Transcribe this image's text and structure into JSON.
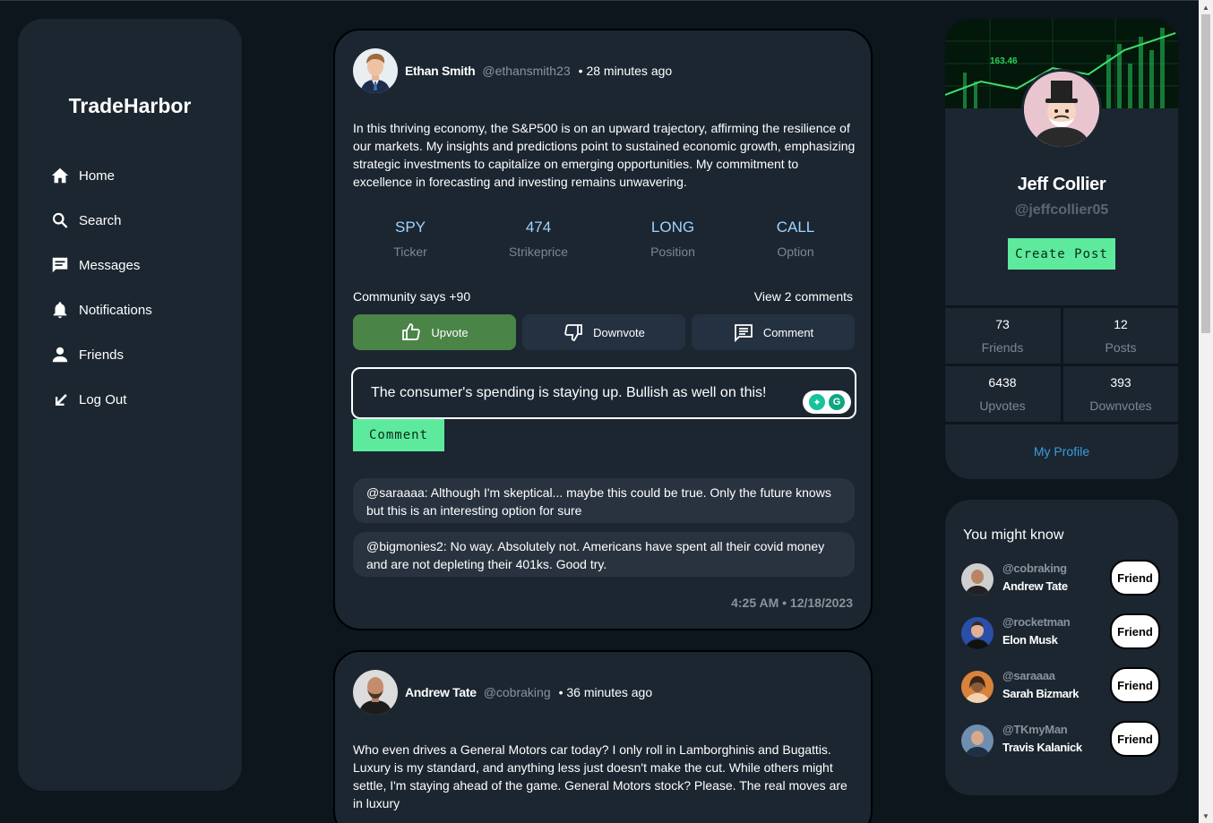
{
  "app": {
    "brand": "TradeHarbor"
  },
  "nav": [
    {
      "label": "Home",
      "icon": "home-icon"
    },
    {
      "label": "Search",
      "icon": "search-icon"
    },
    {
      "label": "Messages",
      "icon": "message-icon"
    },
    {
      "label": "Notifications",
      "icon": "bell-icon"
    },
    {
      "label": "Friends",
      "icon": "person-icon"
    },
    {
      "label": "Log Out",
      "icon": "logout-arrow-icon"
    }
  ],
  "posts": [
    {
      "author": "Ethan Smith",
      "handle": "@ethansmith23",
      "time": "• 28 minutes ago",
      "body": "In this thriving economy, the S&P500 is on an upward trajectory, affirming the resilience of our markets. My insights and predictions point to sustained economic growth, emphasizing strategic investments to capitalize on emerging opportunities. My commitment to excellence in forecasting and investing remains unwavering.",
      "stats": [
        {
          "value": "SPY",
          "label": "Ticker"
        },
        {
          "value": "474",
          "label": "Strikeprice"
        },
        {
          "value": "LONG",
          "label": "Position"
        },
        {
          "value": "CALL",
          "label": "Option"
        }
      ],
      "community": "Community says +90",
      "view_comments": "View 2 comments",
      "actions": {
        "upvote": "Upvote",
        "downvote": "Downvote",
        "comment": "Comment"
      },
      "comment_input_value": "The consumer's spending is staying up. Bullish as well on this!",
      "comment_submit": "Comment",
      "comments": [
        "@saraaaa: Although I'm skeptical... maybe this could be true. Only the future knows but this is an interesting option for sure",
        "@bigmonies2: No way. Absolutely not. Americans have spent all their covid money and are not depleting their 401ks. Good try."
      ],
      "stamp": "4:25 AM • 12/18/2023"
    },
    {
      "author": "Andrew Tate",
      "handle": "@cobraking",
      "time": "• 36 minutes ago",
      "body": "Who even drives a General Motors car today? I only roll in Lamborghinis and Bugattis. Luxury is my standard, and anything less just doesn't make the cut. While others might settle, I'm staying ahead of the game. General Motors stock? Please. The real moves are in luxury"
    }
  ],
  "profile": {
    "name": "Jeff Collier",
    "handle": "@jeffcollier05",
    "create_post": "Create Post",
    "cover_ticker": "163.46",
    "stats": [
      {
        "value": "73",
        "label": "Friends"
      },
      {
        "value": "12",
        "label": "Posts"
      },
      {
        "value": "6438",
        "label": "Upvotes"
      },
      {
        "value": "393",
        "label": "Downvotes"
      }
    ],
    "my_profile": "My Profile"
  },
  "suggestions": {
    "title": "You might know",
    "button": "Friend",
    "people": [
      {
        "handle": "@cobraking",
        "name": "Andrew Tate"
      },
      {
        "handle": "@rocketman",
        "name": "Elon Musk"
      },
      {
        "handle": "@saraaaa",
        "name": "Sarah Bizmark"
      },
      {
        "handle": "@TKmyMan",
        "name": "Travis Kalanick"
      }
    ]
  },
  "colors": {
    "background": "#0d151d",
    "card": "#1b2631",
    "accent_green": "#5dea9d",
    "upvote_green": "#4a8447",
    "stat_blue": "#9fd4ff",
    "link_blue": "#3d9be0"
  }
}
